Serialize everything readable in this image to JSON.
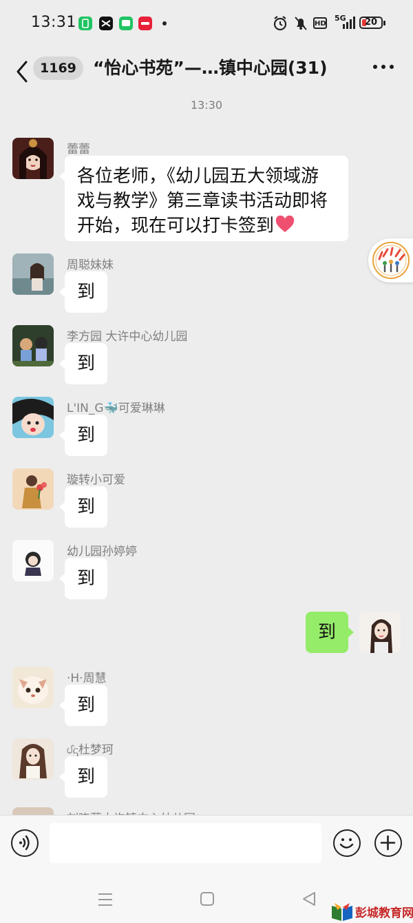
{
  "status_bar": {
    "time": "13:31",
    "network": "5G",
    "hd": "HD",
    "battery": "20",
    "icons": [
      "alarm-icon",
      "mute-icon",
      "hd-icon",
      "signal-icon",
      "battery-icon"
    ]
  },
  "header": {
    "unread_count": "1169",
    "title": "“怡心书苑”—…镇中心园(31)"
  },
  "chat": {
    "timestamp": "13:30",
    "messages": [
      {
        "sender": "蕾蕾",
        "text": "各位老师，《幼儿园五大领域游戏与教学》第三章读书活动即将开始，现在可以打卡签到",
        "emoji": "❤️"
      },
      {
        "sender": "周聪妹妹",
        "text": "到"
      },
      {
        "sender": "李方园 大许中心幼儿园",
        "text": "到"
      },
      {
        "sender": "L'IN_G🐳可爱琳琳",
        "text": "到"
      },
      {
        "sender": "璇转小可爱",
        "text": "到"
      },
      {
        "sender": "幼儿园孙婷婷",
        "text": "到"
      },
      {
        "sender": "",
        "text": "到",
        "self": true
      },
      {
        "sender": "·H·周慧",
        "text": "到"
      },
      {
        "sender": "ᦔᦓ杜梦珂",
        "text": "到"
      },
      {
        "sender": "刘晓蕾大许镇中心幼儿园",
        "text": ""
      }
    ]
  },
  "navbar": {
    "icons": [
      "menu-icon",
      "home-square-icon",
      "back-triangle-icon"
    ]
  },
  "watermark": {
    "text": "彭城教育网"
  },
  "colors": {
    "background": "#ededed",
    "self_bubble": "#95ec69",
    "other_bubble": "#ffffff"
  }
}
